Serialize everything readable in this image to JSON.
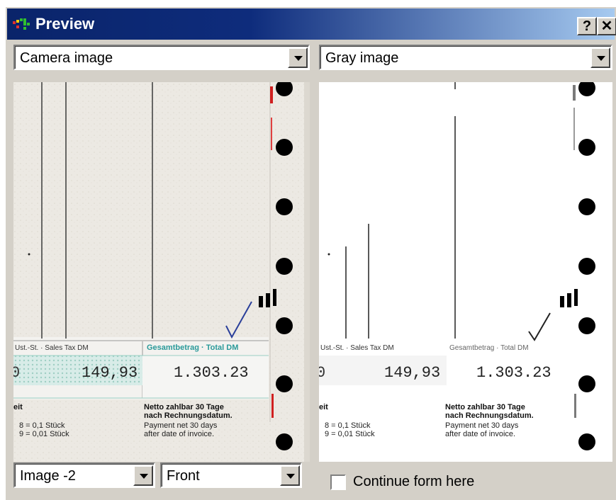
{
  "window": {
    "title": "Preview",
    "help_label": "?",
    "close_label": "✕"
  },
  "left_panel": {
    "view_select": "Camera image",
    "image_select": "Image -2",
    "side_select": "Front"
  },
  "right_panel": {
    "view_select": "Gray image",
    "continue_label": "Continue form here",
    "continue_checked": false
  },
  "document": {
    "col_header_tax": "Ust.-St. · Sales Tax DM",
    "col_header_total": "Gesamtbetrag · Total DM",
    "tax_amount": "149,93",
    "total_amount": "1.303.23",
    "zero": "0",
    "label_eit": "eit",
    "qty_line1": "8 = 0,1   Stück",
    "qty_line2": "9 = 0,01 Stück",
    "terms_de_1": "Netto zahlbar 30 Tage",
    "terms_de_2": "nach Rechnungsdatum.",
    "terms_en_1": "Payment net 30 days",
    "terms_en_2": "after date of invoice."
  },
  "colors": {
    "title_bar": "#0a246a",
    "window_face": "#d4d0c8",
    "teal_header": "#2a9a9a",
    "check_blue": "#2a3f9a",
    "red_mark": "#d02020"
  }
}
